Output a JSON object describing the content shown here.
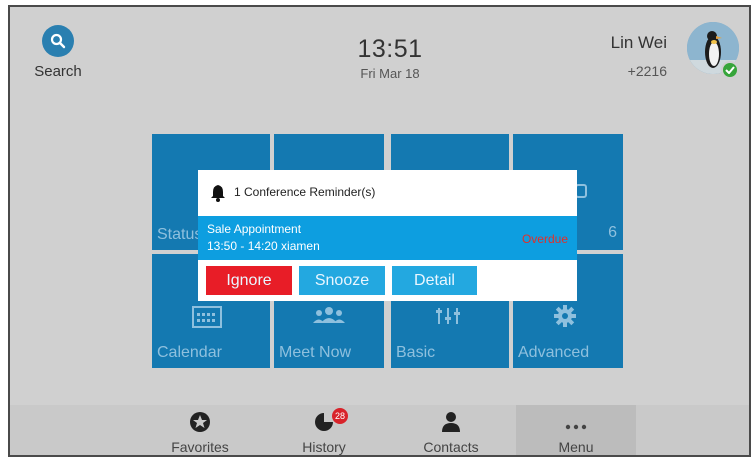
{
  "header": {
    "search_label": "Search",
    "time": "13:51",
    "date": "Fri Mar 18",
    "user_name": "Lin Wei",
    "user_ext": "+2216",
    "presence": "online"
  },
  "tiles": [
    {
      "label": "Status",
      "icon": "status-icon"
    },
    {
      "label": "",
      "icon": ""
    },
    {
      "label": "6",
      "icon": "phone-icon"
    },
    {
      "label": "Calendar",
      "icon": "calendar-icon"
    },
    {
      "label": "Meet Now",
      "icon": "group-icon"
    },
    {
      "label": "Basic",
      "icon": "sliders-icon"
    },
    {
      "label": "Advanced",
      "icon": "gear-icon"
    }
  ],
  "dock": [
    {
      "label": "Favorites",
      "icon": "star-icon"
    },
    {
      "label": "History",
      "icon": "history-icon",
      "badge": "28"
    },
    {
      "label": "Contacts",
      "icon": "person-icon"
    },
    {
      "label": "Menu",
      "icon": "more-icon",
      "active": true
    }
  ],
  "dialog": {
    "title": "1 Conference Reminder(s)",
    "subject": "Sale Appointment",
    "when": "13:50 - 14:20 xiamen",
    "status": "Overdue",
    "buttons": {
      "ignore": "Ignore",
      "snooze": "Snooze",
      "detail": "Detail"
    }
  },
  "colors": {
    "tile": "#1479b1",
    "accent": "#0d9ee0",
    "danger": "#e81d27",
    "overdue": "#e0302a"
  }
}
